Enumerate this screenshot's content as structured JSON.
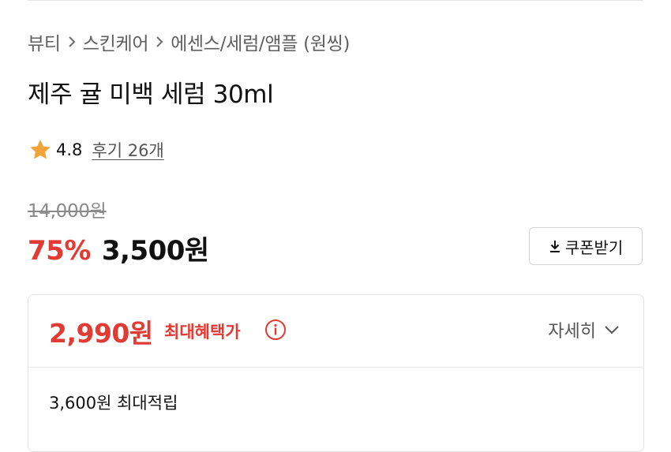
{
  "breadcrumb": {
    "items": [
      "뷰티",
      "스킨케어",
      "에센스/세럼/앰플 (원씽)"
    ]
  },
  "product": {
    "title": "제주 귤 미백 세럼 30ml"
  },
  "rating": {
    "score": "4.8",
    "reviews_label": "후기 26개",
    "star_color": "#f2a33a"
  },
  "pricing": {
    "original_price": "14,000원",
    "discount_rate": "75%",
    "sale_price": "3,500원",
    "coupon_label": "쿠폰받기",
    "accent_color": "#e23b34"
  },
  "benefit": {
    "max_price": "2,990원",
    "max_label": "최대혜택가",
    "detail_label": "자세히",
    "points_text": "3,600원 최대적립"
  },
  "icons": [
    "chevron-right-icon",
    "star-icon",
    "download-icon",
    "info-icon",
    "chevron-down-icon"
  ]
}
